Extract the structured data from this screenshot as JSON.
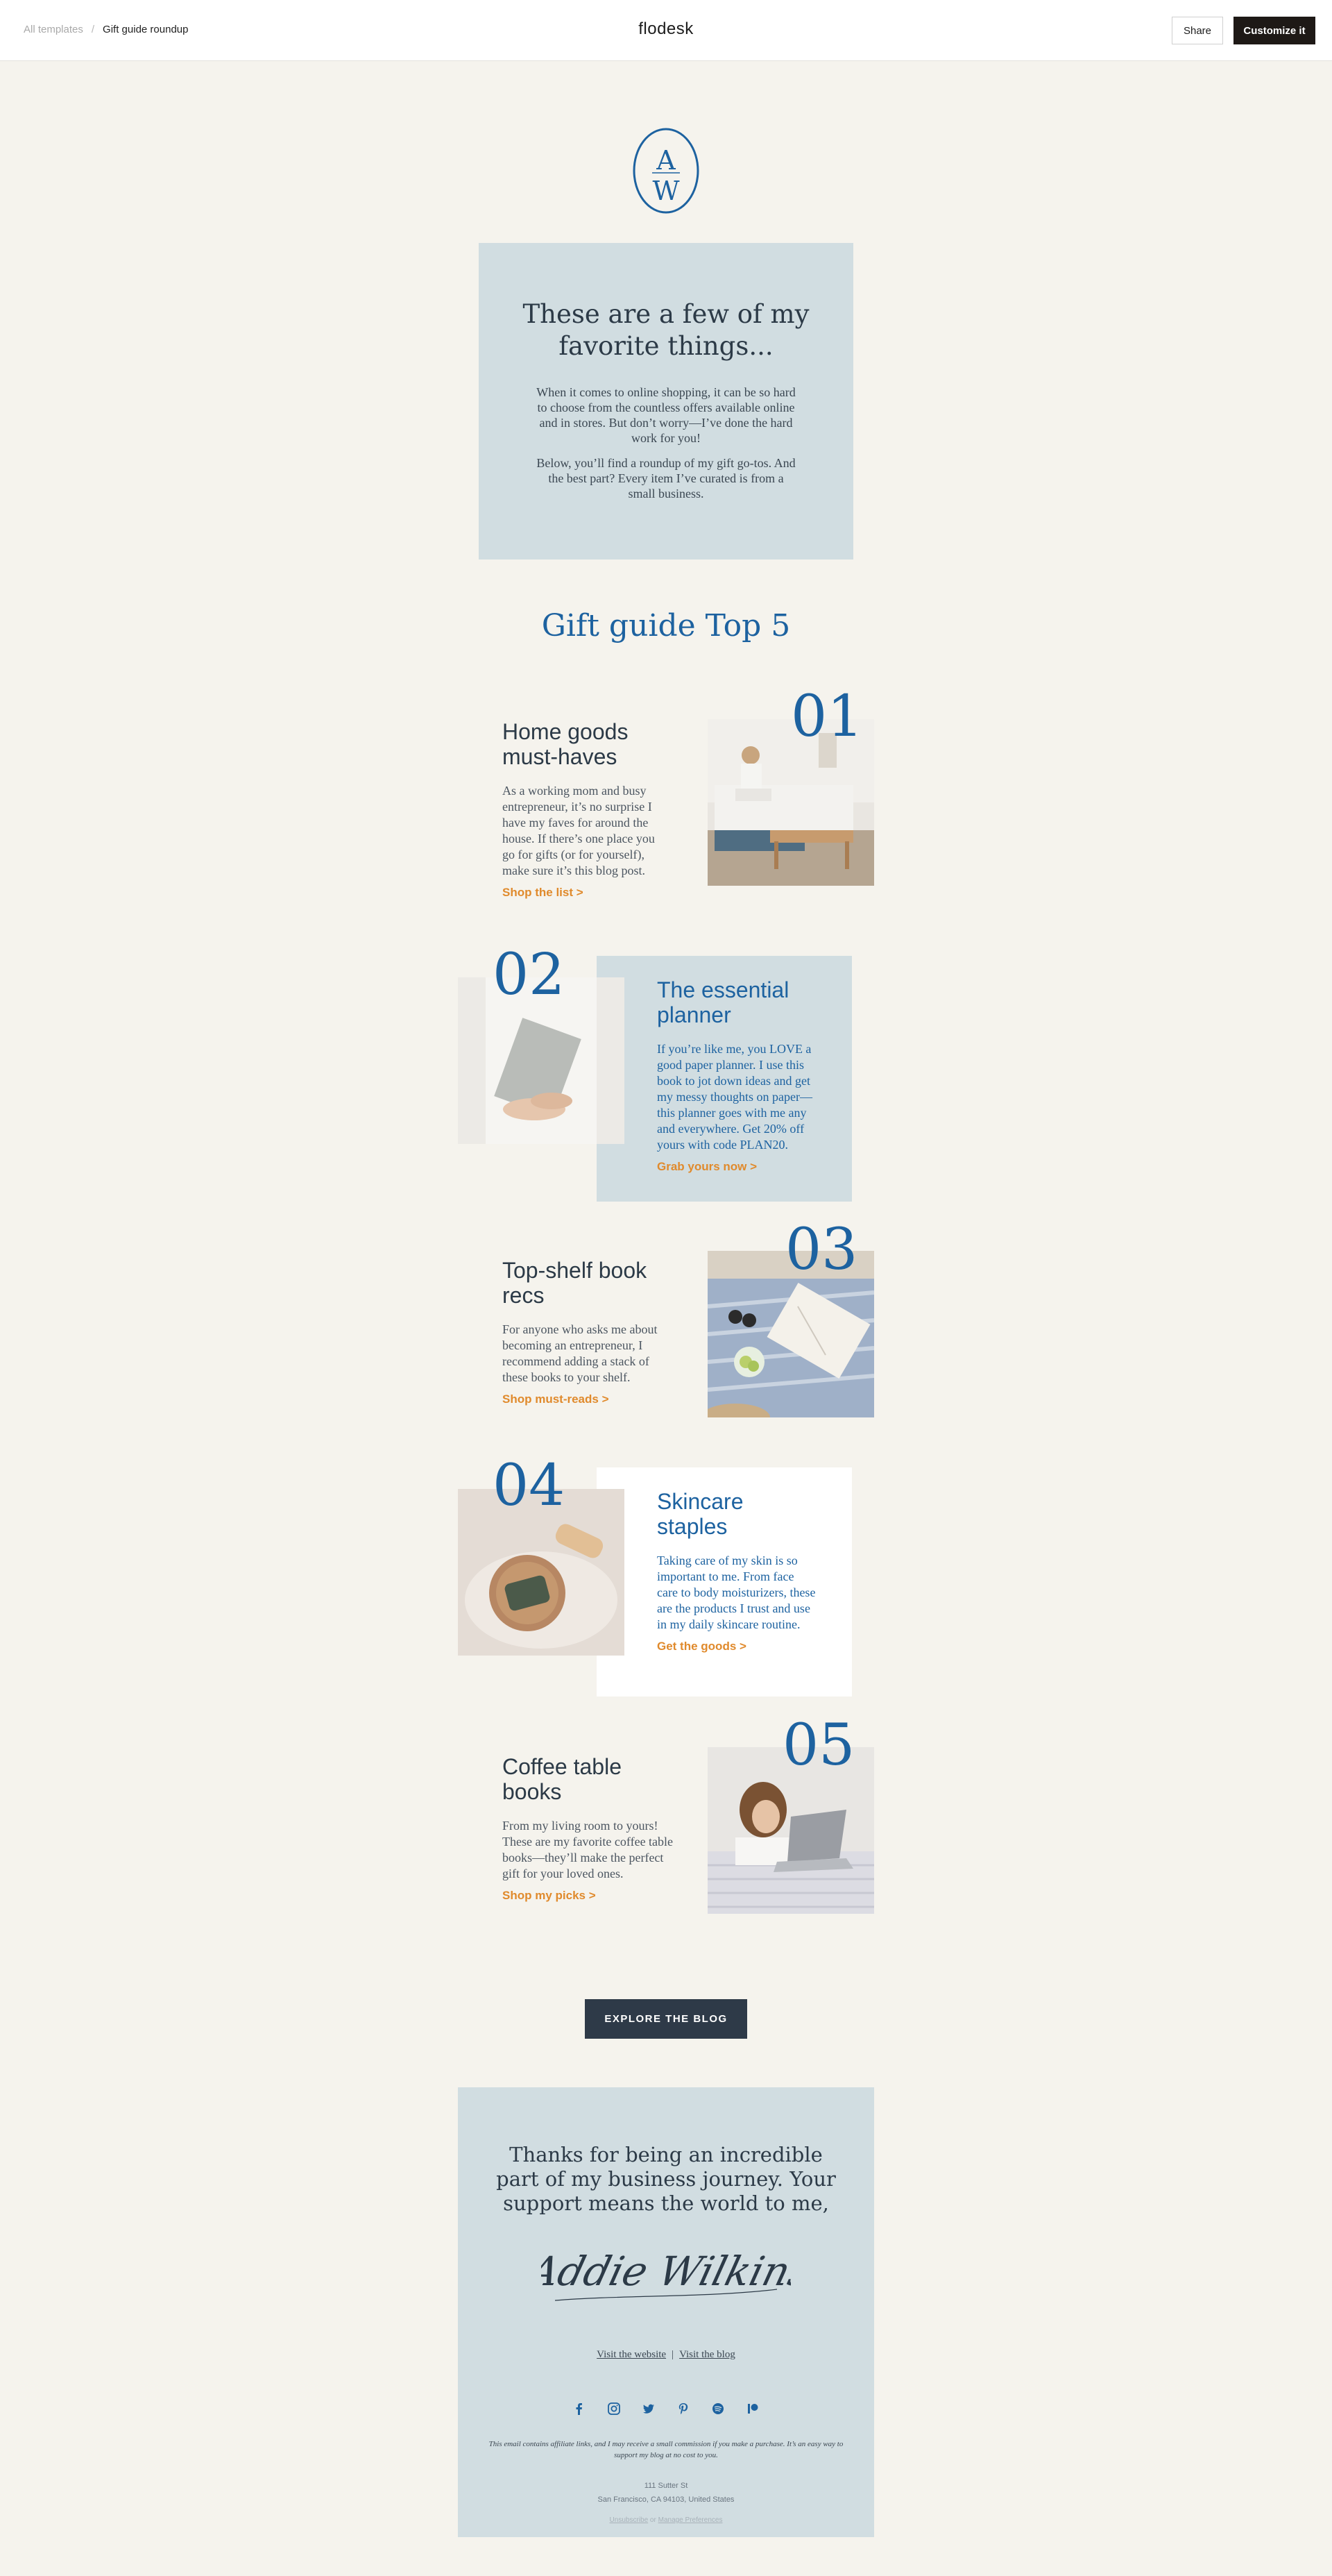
{
  "topbar": {
    "breadcrumb_root": "All templates",
    "breadcrumb_sep": "/",
    "breadcrumb_current": "Gift guide roundup",
    "brand": "flodesk",
    "share_label": "Share",
    "customize_label": "Customize it"
  },
  "logo": {
    "top_letter": "A",
    "bottom_letter": "W"
  },
  "intro": {
    "heading": "These are a few of my favorite things...",
    "p1": "When it comes to online shopping, it can be so hard to choose from the countless offers available online and in stores. But don’t worry—I’ve done the hard work for you!",
    "p2": "Below, you’ll find a roundup of my gift go-tos. And the best part? Every item I’ve curated is from a small business."
  },
  "gift_title": "Gift guide Top 5",
  "items": [
    {
      "num": "01",
      "title": "Home goods must-haves",
      "body": "As a working mom and busy entrepreneur, it’s no surprise I have my faves for around the house. If there’s one place you go for gifts (or for yourself), make sure it’s this blog post.",
      "cta": "Shop the list >",
      "photo_icon": "woman-on-sofa-photo"
    },
    {
      "num": "02",
      "title": "The essential planner",
      "body": "If you’re like me, you LOVE a good paper planner. I use this book to jot down ideas and get my messy thoughts on paper—this planner goes with me any and everywhere. Get 20% off yours with code PLAN20.",
      "cta": "Grab yours now >",
      "photo_icon": "planner-in-hands-photo"
    },
    {
      "num": "03",
      "title": "Top-shelf book recs",
      "body": "For anyone who asks me about becoming an entrepreneur, I recommend adding a stack of these books to your shelf.",
      "cta": "Shop must-reads >",
      "photo_icon": "book-on-blanket-photo"
    },
    {
      "num": "04",
      "title": "Skincare staples",
      "body": "Taking care of my skin is so important to me. From face care to body moisturizers, these are the products I trust and use in my daily skincare routine.",
      "cta": "Get the goods >",
      "photo_icon": "soap-and-brush-photo"
    },
    {
      "num": "05",
      "title": "Coffee table books",
      "body": "From my living room to yours! These are my favorite coffee table books—they’ll make the perfect gift for your loved ones.",
      "cta": "Shop my picks >",
      "photo_icon": "woman-with-laptop-photo"
    }
  ],
  "explore_label": "EXPLORE THE BLOG",
  "footer": {
    "thanks": "Thanks for being an incredible part of my business journey. Your support means the world to me,",
    "signature": "Addie Wilkins",
    "link_website": "Visit the website",
    "link_sep": "|",
    "link_blog": "Visit the blog",
    "socials": [
      "facebook-icon",
      "instagram-icon",
      "twitter-icon",
      "pinterest-icon",
      "spotify-icon",
      "patreon-icon"
    ],
    "disclaimer": "This email contains affiliate links, and I may receive a small commission if you make a purchase. It’s an easy way to support my blog at no cost to you.",
    "address_line1": "111 Sutter St",
    "address_line2": "San Francisco, CA 94103, United States",
    "unsubscribe": "Unsubscribe",
    "fine_sep": "or",
    "manage": "Manage Preferences"
  },
  "colors": {
    "background": "#f5f3ed",
    "panel_blue": "#d1dde1",
    "accent_blue": "#1d62a0",
    "cta_orange": "#e08a2c",
    "navy": "#2e3a48"
  }
}
